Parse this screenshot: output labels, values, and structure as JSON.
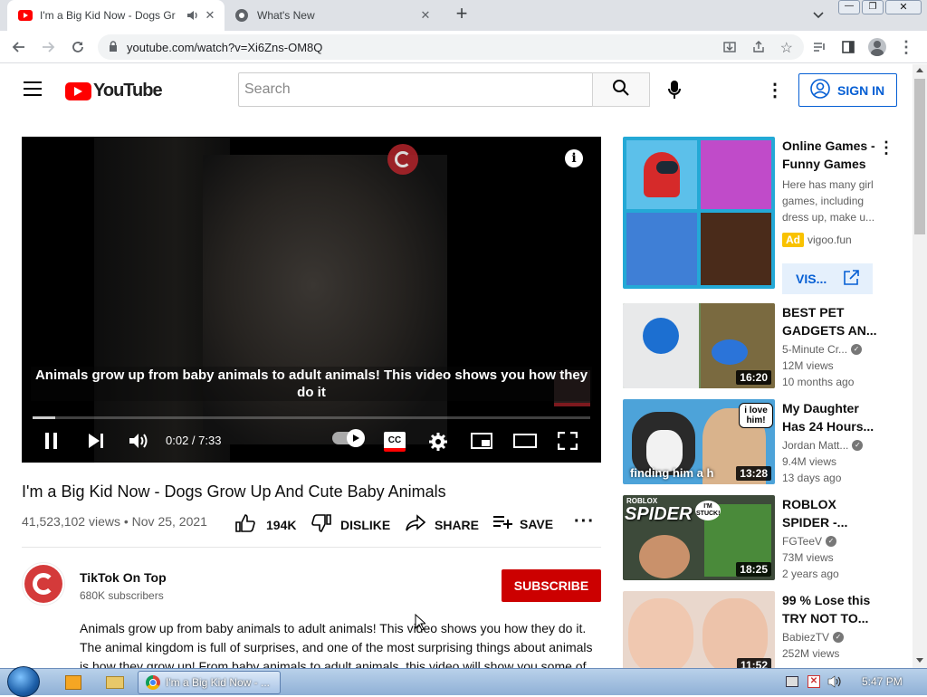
{
  "browser": {
    "tabs": [
      {
        "title": "I'm a Big Kid Now - Dogs Gr",
        "active": true
      },
      {
        "title": "What's New",
        "active": false
      }
    ],
    "new_tab": "+",
    "url": "youtube.com/watch?v=Xi6Zns-OM8Q"
  },
  "header": {
    "logo_text": "YouTube",
    "search_placeholder": "Search",
    "sign_in_label": "SIGN IN"
  },
  "player": {
    "caption": "Animals grow up from baby animals to adult animals! This video shows you how they do it",
    "time": "0:02 / 7:33",
    "progress": 0.004
  },
  "video": {
    "title": "I'm a Big Kid Now - Dogs Grow Up And Cute Baby Animals",
    "views": "41,523,102 views",
    "date": "Nov 25, 2021",
    "separator": "•",
    "likes": "194K",
    "dislike_label": "DISLIKE",
    "share_label": "SHARE",
    "save_label": "SAVE"
  },
  "channel": {
    "name": "TikTok On Top",
    "subscribers": "680K subscribers",
    "subscribe_label": "SUBSCRIBE"
  },
  "description": "Animals grow up from baby animals to adult animals! This video shows you how they do it. The animal kingdom is full of surprises, and one of the most surprising things about animals is how they grow up! From baby animals to adult animals, this video will show you some of",
  "ad": {
    "title": "Online Games - Funny Games",
    "text": "Here has many girl games, including dress up, make u...",
    "badge": "Ad",
    "domain": "vigoo.fun",
    "visit_label": "VIS..."
  },
  "recommendations": [
    {
      "title": "BEST PET GADGETS AN...",
      "channel": "5-Minute Cr...",
      "views": "12M views",
      "age": "10 months ago",
      "duration": "16:20",
      "verified": true
    },
    {
      "title": "My Daughter Has 24 Hours...",
      "channel": "Jordan Matt...",
      "views": "9.4M views",
      "age": "13 days ago",
      "duration": "13:28",
      "verified": true,
      "thumb_text": "finding him a h",
      "bubble": "i love him!"
    },
    {
      "title": "ROBLOX SPIDER -...",
      "channel": "FGTeeV",
      "views": "73M views",
      "age": "2 years ago",
      "duration": "18:25",
      "verified": true,
      "thumb_text": "SPIDER",
      "thumb_small": "ROBLOX",
      "bubble": "I'M STUCK!"
    },
    {
      "title": "99 % Lose this TRY NOT TO...",
      "channel": "BabiezTV",
      "views": "252M views",
      "age": "",
      "duration": "11:52",
      "verified": true
    }
  ],
  "taskbar": {
    "window_label": "I'm a Big Kid Now - ...",
    "clock": "5:47 PM"
  }
}
